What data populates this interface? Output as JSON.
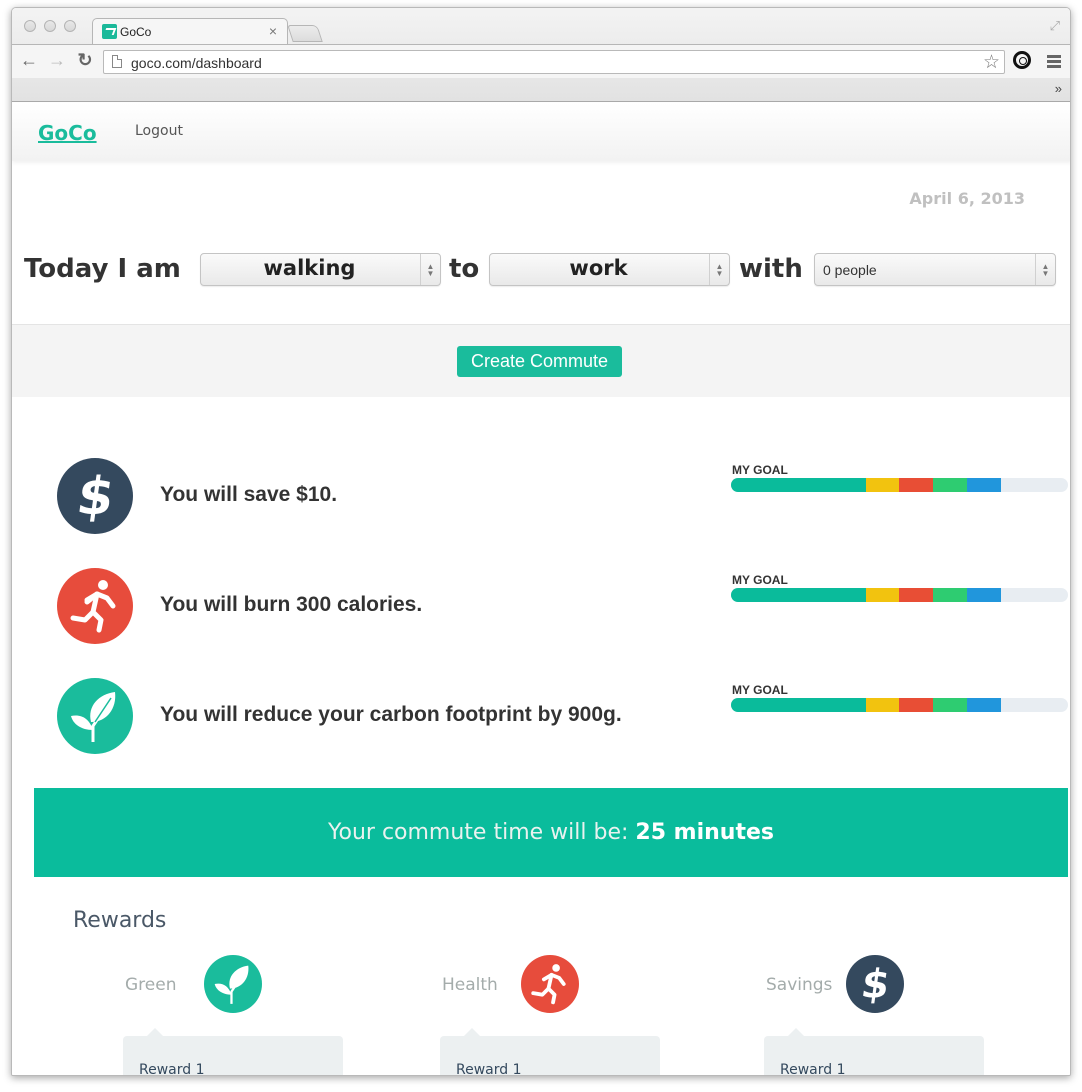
{
  "browser": {
    "tab_title": "GoCo",
    "tab_close": "×",
    "url": "goco.com/dashboard",
    "star_glyph": "☆",
    "back_glyph": "←",
    "forward_glyph": "→",
    "reload_glyph": "↻",
    "fullscreen_glyph": "⤢",
    "chevrons_glyph": "»"
  },
  "navbar": {
    "brand": "GoCo",
    "logout": "Logout"
  },
  "date": "April 6, 2013",
  "commute_form": {
    "prefix": "Today I am",
    "mode_value": "walking",
    "connector_to": "to",
    "destination_value": "work",
    "connector_with": "with",
    "companions_value": "0 people",
    "arrows_glyph": "▲\n▼",
    "create_button": "Create Commute"
  },
  "stats": [
    {
      "icon": "dollar-icon",
      "text": "You will save $10.",
      "goal_label": "MY GOAL",
      "color": "#34495e"
    },
    {
      "icon": "runner-icon",
      "text": "You will burn 300 calories.",
      "goal_label": "MY GOAL",
      "color": "#e74c3c"
    },
    {
      "icon": "leaf-icon",
      "text": "You will reduce your carbon footprint by 900g.",
      "goal_label": "MY GOAL",
      "color": "#1abc9c"
    }
  ],
  "goal_progress": {
    "segments": [
      {
        "name": "base",
        "percent": 40,
        "color": "#0abb9b"
      },
      {
        "name": "yellow",
        "percent": 10,
        "color": "#f2c30f"
      },
      {
        "name": "red",
        "percent": 10,
        "color": "#e84e35"
      },
      {
        "name": "green",
        "percent": 10,
        "color": "#2ecc71"
      },
      {
        "name": "blue",
        "percent": 10,
        "color": "#2196dc"
      }
    ],
    "total_percent": 80,
    "track_color": "#e8edf2"
  },
  "commute_time": {
    "label": "Your commute time will be: ",
    "value": "25 minutes"
  },
  "rewards": {
    "title": "Rewards",
    "categories": [
      {
        "name": "Green",
        "icon": "leaf-icon",
        "color": "#1abc9c",
        "card_label": "Reward 1"
      },
      {
        "name": "Health",
        "icon": "runner-icon",
        "color": "#e74c3c",
        "card_label": "Reward 1"
      },
      {
        "name": "Savings",
        "icon": "dollar-icon",
        "color": "#34495e",
        "card_label": "Reward 1"
      }
    ]
  },
  "colors": {
    "brand": "#1abc9c",
    "accent_banner": "#0abc9c",
    "dark": "#34495e",
    "health": "#e74c3c"
  }
}
